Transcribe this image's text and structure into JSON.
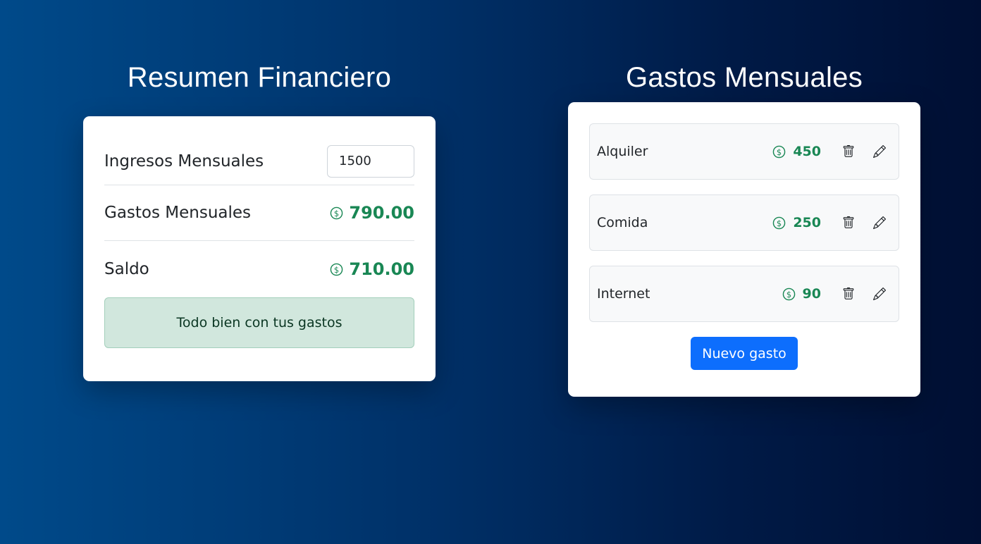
{
  "summary": {
    "title": "Resumen Financiero",
    "income_label": "Ingresos Mensuales",
    "income_value": "1500",
    "expenses_label": "Gastos Mensuales",
    "expenses_total": "790.00",
    "balance_label": "Saldo",
    "balance_value": "710.00",
    "status_message": "Todo bien con tus gastos",
    "currency_icon": "dollar-circle-icon"
  },
  "expenses": {
    "title": "Gastos Mensuales",
    "items": [
      {
        "name": "Alquiler",
        "amount": "450"
      },
      {
        "name": "Comida",
        "amount": "250"
      },
      {
        "name": "Internet",
        "amount": "90"
      }
    ],
    "item_icons": [
      "dollar-circle-icon",
      "trash-icon",
      "pencil-icon"
    ],
    "new_button_label": "Nuevo gasto"
  },
  "colors": {
    "accent_green": "#198754",
    "primary_blue": "#0d6efd",
    "alert_bg": "#d1e7dd",
    "background_start": "#004a8a",
    "background_end": "#000f33"
  }
}
